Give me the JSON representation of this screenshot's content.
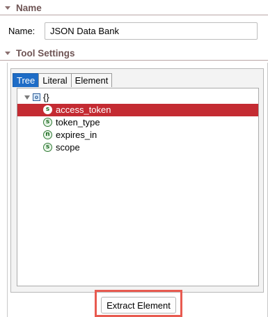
{
  "sections": {
    "name": {
      "title": "Name"
    },
    "tool_settings": {
      "title": "Tool Settings"
    }
  },
  "name_field": {
    "label": "Name:",
    "value": "JSON Data Bank"
  },
  "tabs": [
    {
      "label": "Tree",
      "active": true
    },
    {
      "label": "Literal",
      "active": false
    },
    {
      "label": "Element",
      "active": false
    }
  ],
  "tree": {
    "root": {
      "icon": "object-icon",
      "icon_glyph": "o",
      "label": "{}"
    },
    "children": [
      {
        "icon": "string-icon",
        "icon_glyph": "s",
        "label": "access_token",
        "selected": true
      },
      {
        "icon": "string-icon",
        "icon_glyph": "s",
        "label": "token_type",
        "selected": false
      },
      {
        "icon": "number-icon",
        "icon_glyph": "n",
        "label": "expires_in",
        "selected": false
      },
      {
        "icon": "string-icon",
        "icon_glyph": "s",
        "label": "scope",
        "selected": false
      }
    ]
  },
  "extract_button": {
    "label": "Extract Element"
  },
  "colors": {
    "selection": "#c42b32",
    "active_tab": "#1e6cc6",
    "section_title": "#6e5454",
    "highlight": "#e85a50"
  }
}
